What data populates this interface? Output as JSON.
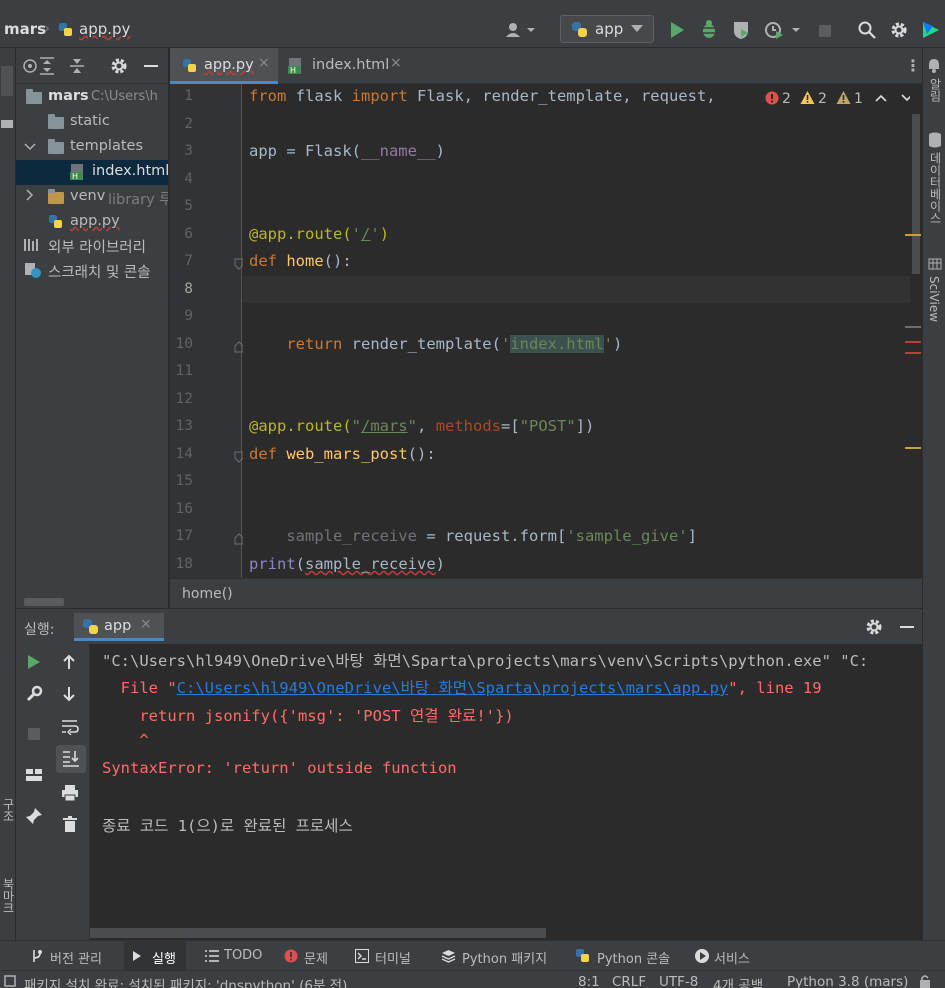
{
  "toolbar": {
    "project_name": "mars",
    "current_file": "app.py",
    "run_config": "app"
  },
  "project": {
    "root_name": "mars",
    "root_path": "C:\\Users\\h",
    "items": [
      {
        "label": "static"
      },
      {
        "label": "templates"
      },
      {
        "label": "index.html"
      },
      {
        "label": "venv",
        "note": "library 루"
      },
      {
        "label": "app.py"
      },
      {
        "label": "외부 라이브러리"
      },
      {
        "label": "스크래치 및 콘솔"
      }
    ]
  },
  "editor": {
    "tabs": [
      {
        "label": "app.py"
      },
      {
        "label": "index.html"
      }
    ],
    "inspections": {
      "errors": "2",
      "warnings": "2",
      "weak_warnings": "1"
    },
    "line_numbers": [
      "1",
      "2",
      "3",
      "4",
      "5",
      "6",
      "7",
      "8",
      "9",
      "10",
      "11",
      "12",
      "13",
      "14",
      "15",
      "16",
      "17",
      "18"
    ],
    "breadcrumb": "home()"
  },
  "right_strip": {
    "notifications": "알림",
    "database": "데이터베이스",
    "sciview": "SciView"
  },
  "run": {
    "label": "실행:",
    "tab": "app",
    "console": {
      "cmd": "\"C:\\Users\\hl949\\OneDrive\\바탕 화면\\Sparta\\projects\\mars\\venv\\Scripts\\python.exe\" \"C:",
      "file_prefix": "  File \"",
      "file_path": "C:\\Users\\hl949\\OneDrive\\바탕 화면\\Sparta\\projects\\mars\\app.py",
      "file_suffix": "\", line 19",
      "code": "    return jsonify({'msg': 'POST 연결 완료!'})",
      "caret": "    ^",
      "error": "SyntaxError: 'return' outside function",
      "exit": "종료 코드 1(으)로 완료된 프로세스"
    }
  },
  "tool_tabs": [
    {
      "label": "버전 관리"
    },
    {
      "label": "실행"
    },
    {
      "label": "TODO"
    },
    {
      "label": "문제"
    },
    {
      "label": "터미널"
    },
    {
      "label": "Python 패키지"
    },
    {
      "label": "Python 콘솔"
    },
    {
      "label": "서비스"
    }
  ],
  "status": {
    "message": "패키지 설치 완료: 설치된 패키지: 'dnspython' (6분 전)",
    "position": "8:1",
    "line_sep": "CRLF",
    "encoding": "UTF-8",
    "indent": "4개 공백",
    "interpreter": "Python 3.8 (mars)"
  },
  "left_strip": {
    "structure": "구조",
    "bookmarks": "북마크"
  },
  "colors": {
    "accent": "#4a88c7",
    "error": "#ff6b68",
    "link": "#287bde",
    "run_green": "#59a869"
  }
}
